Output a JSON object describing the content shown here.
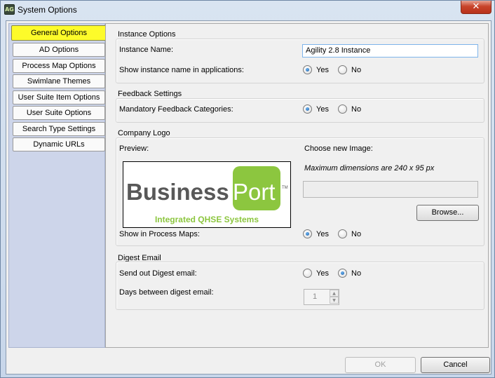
{
  "window": {
    "title": "System Options",
    "icon_text": "AG",
    "close_glyph": "✕"
  },
  "nav": {
    "items": [
      {
        "label": "General Options",
        "active": true
      },
      {
        "label": "AD Options"
      },
      {
        "label": "Process Map Options"
      },
      {
        "label": "Swimlane Themes"
      },
      {
        "label": "User Suite Item Options"
      },
      {
        "label": "User Suite Options"
      },
      {
        "label": "Search Type Settings"
      },
      {
        "label": "Dynamic URLs"
      }
    ]
  },
  "instance": {
    "title": "Instance Options",
    "name_label": "Instance Name:",
    "name_value": "Agility 2.8 Instance",
    "show_label": "Show instance name in applications:",
    "yes": "Yes",
    "no": "No",
    "selected": "Yes"
  },
  "feedback": {
    "title": "Feedback Settings",
    "mandatory_label": "Mandatory Feedback Categories:",
    "yes": "Yes",
    "no": "No",
    "selected": "Yes"
  },
  "logo": {
    "title": "Company Logo",
    "preview_label": "Preview:",
    "choose_label": "Choose new Image:",
    "max_dims": "Maximum dimensions are 240 x 95 px",
    "file_path": "",
    "browse_label": "Browse...",
    "show_in_maps_label": "Show in Process Maps:",
    "yes": "Yes",
    "no": "No",
    "selected": "Yes",
    "image": {
      "word1": "Business",
      "word2": "Port",
      "trademark": "TM",
      "tagline": "Integrated QHSE Systems",
      "green": "#8cc63f",
      "grey": "#585858"
    }
  },
  "digest": {
    "title": "Digest Email",
    "send_label": "Send out Digest email:",
    "yes": "Yes",
    "no": "No",
    "selected": "No",
    "days_label": "Days between digest email:",
    "days_value": "1",
    "up_glyph": "▲",
    "down_glyph": "▼"
  },
  "footer": {
    "ok_label": "OK",
    "cancel_label": "Cancel"
  },
  "colors": {
    "active_tab": "#fdfb2a",
    "nav_bg": "#cdd5ea",
    "radio_selected": "#1c5fa8",
    "close_button": "#c8442b"
  }
}
